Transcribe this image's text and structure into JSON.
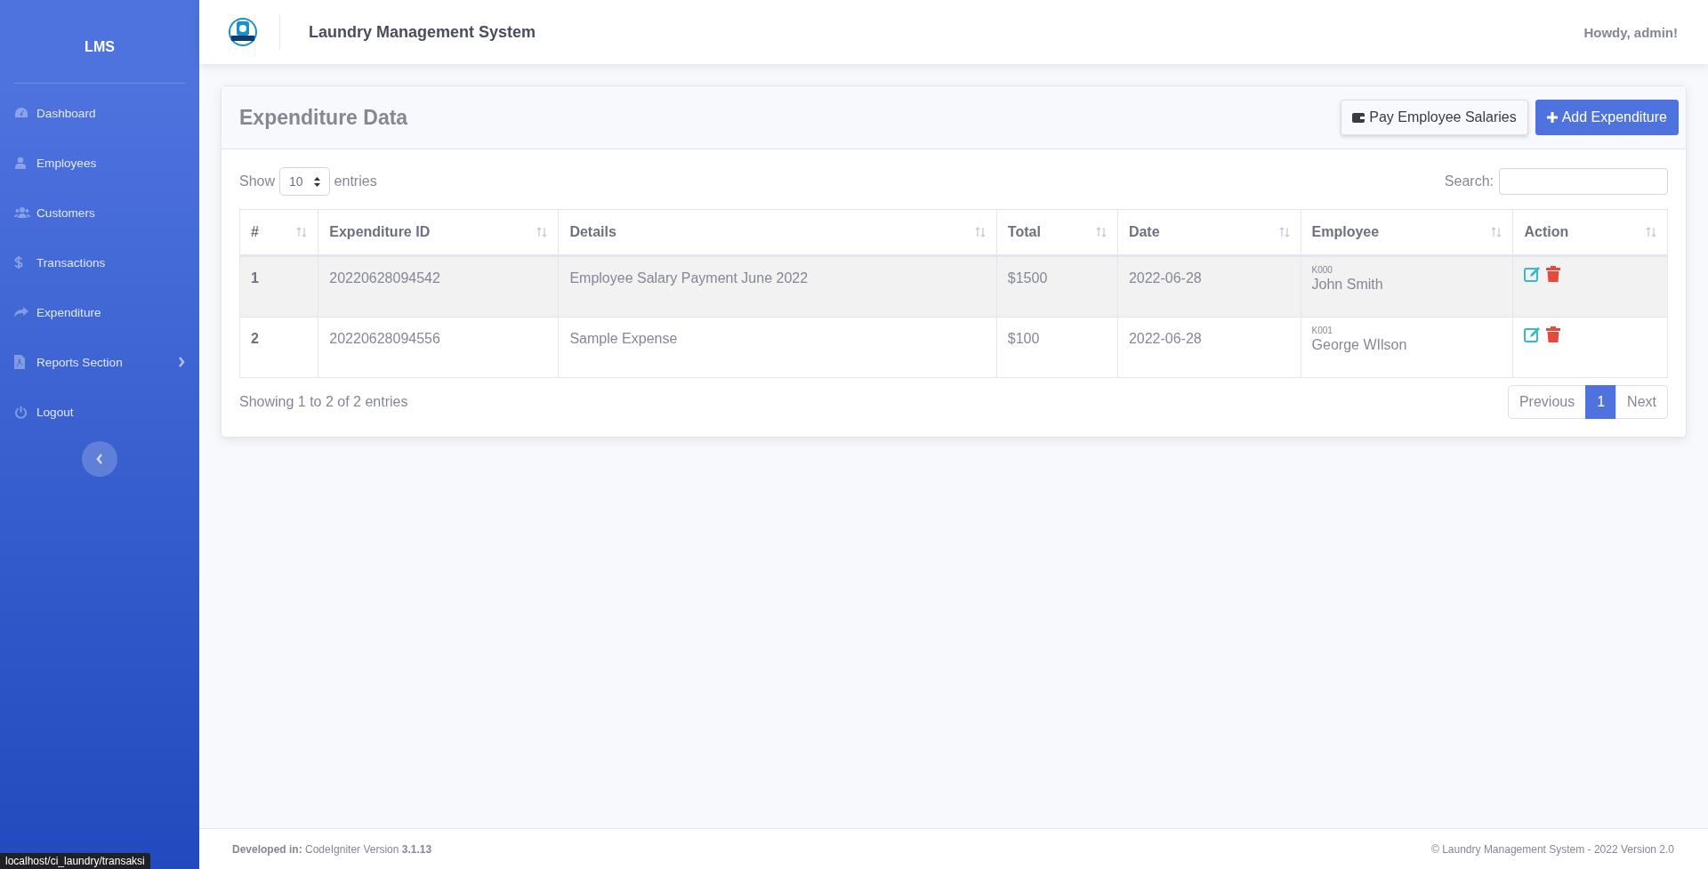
{
  "sidebar": {
    "brand": "LMS",
    "items": [
      {
        "label": "Dashboard",
        "has_submenu": false
      },
      {
        "label": "Employees",
        "has_submenu": false
      },
      {
        "label": "Customers",
        "has_submenu": false
      },
      {
        "label": "Transactions",
        "has_submenu": false
      },
      {
        "label": "Expenditure",
        "has_submenu": false
      },
      {
        "label": "Reports Section",
        "has_submenu": true
      },
      {
        "label": "Logout",
        "has_submenu": false
      }
    ]
  },
  "topbar": {
    "title": "Laundry Management System",
    "greeting": "Howdy, admin!"
  },
  "card": {
    "title": "Expenditure Data",
    "buttons": [
      {
        "label": "Pay Employee Salaries",
        "kind": "secondary"
      },
      {
        "label": "Add Expenditure",
        "kind": "primary"
      }
    ],
    "length": {
      "before": "Show",
      "value": "10",
      "after": "entries"
    },
    "search": {
      "label": "Search:"
    },
    "table": {
      "columns": [
        "#",
        "Expenditure ID",
        "Details",
        "Total",
        "Date",
        "Employee",
        "Action"
      ],
      "rows": [
        {
          "index": "1",
          "id": "20220628094542",
          "details": "Employee Salary Payment June 2022",
          "total": "$1500",
          "date": "2022-06-28",
          "employee_code": "K000",
          "employee_name": "John Smith"
        },
        {
          "index": "2",
          "id": "20220628094556",
          "details": "Sample Expense",
          "total": "$100",
          "date": "2022-06-28",
          "employee_code": "K001",
          "employee_name": "George WIlson"
        }
      ]
    },
    "info": "Showing 1 to 2 of 2 entries",
    "pagination": [
      {
        "label": "Previous",
        "selected": false
      },
      {
        "label": "1",
        "selected": true
      },
      {
        "label": "Next",
        "selected": false
      }
    ]
  },
  "footer": {
    "left_label": "Developed in:",
    "left_text": "CodeIgniter Version",
    "left_version": "3.1.13",
    "right": "© Laundry Management System - 2022 Version 2.0"
  },
  "status_url": "localhost/ci_laundry/transaksi"
}
